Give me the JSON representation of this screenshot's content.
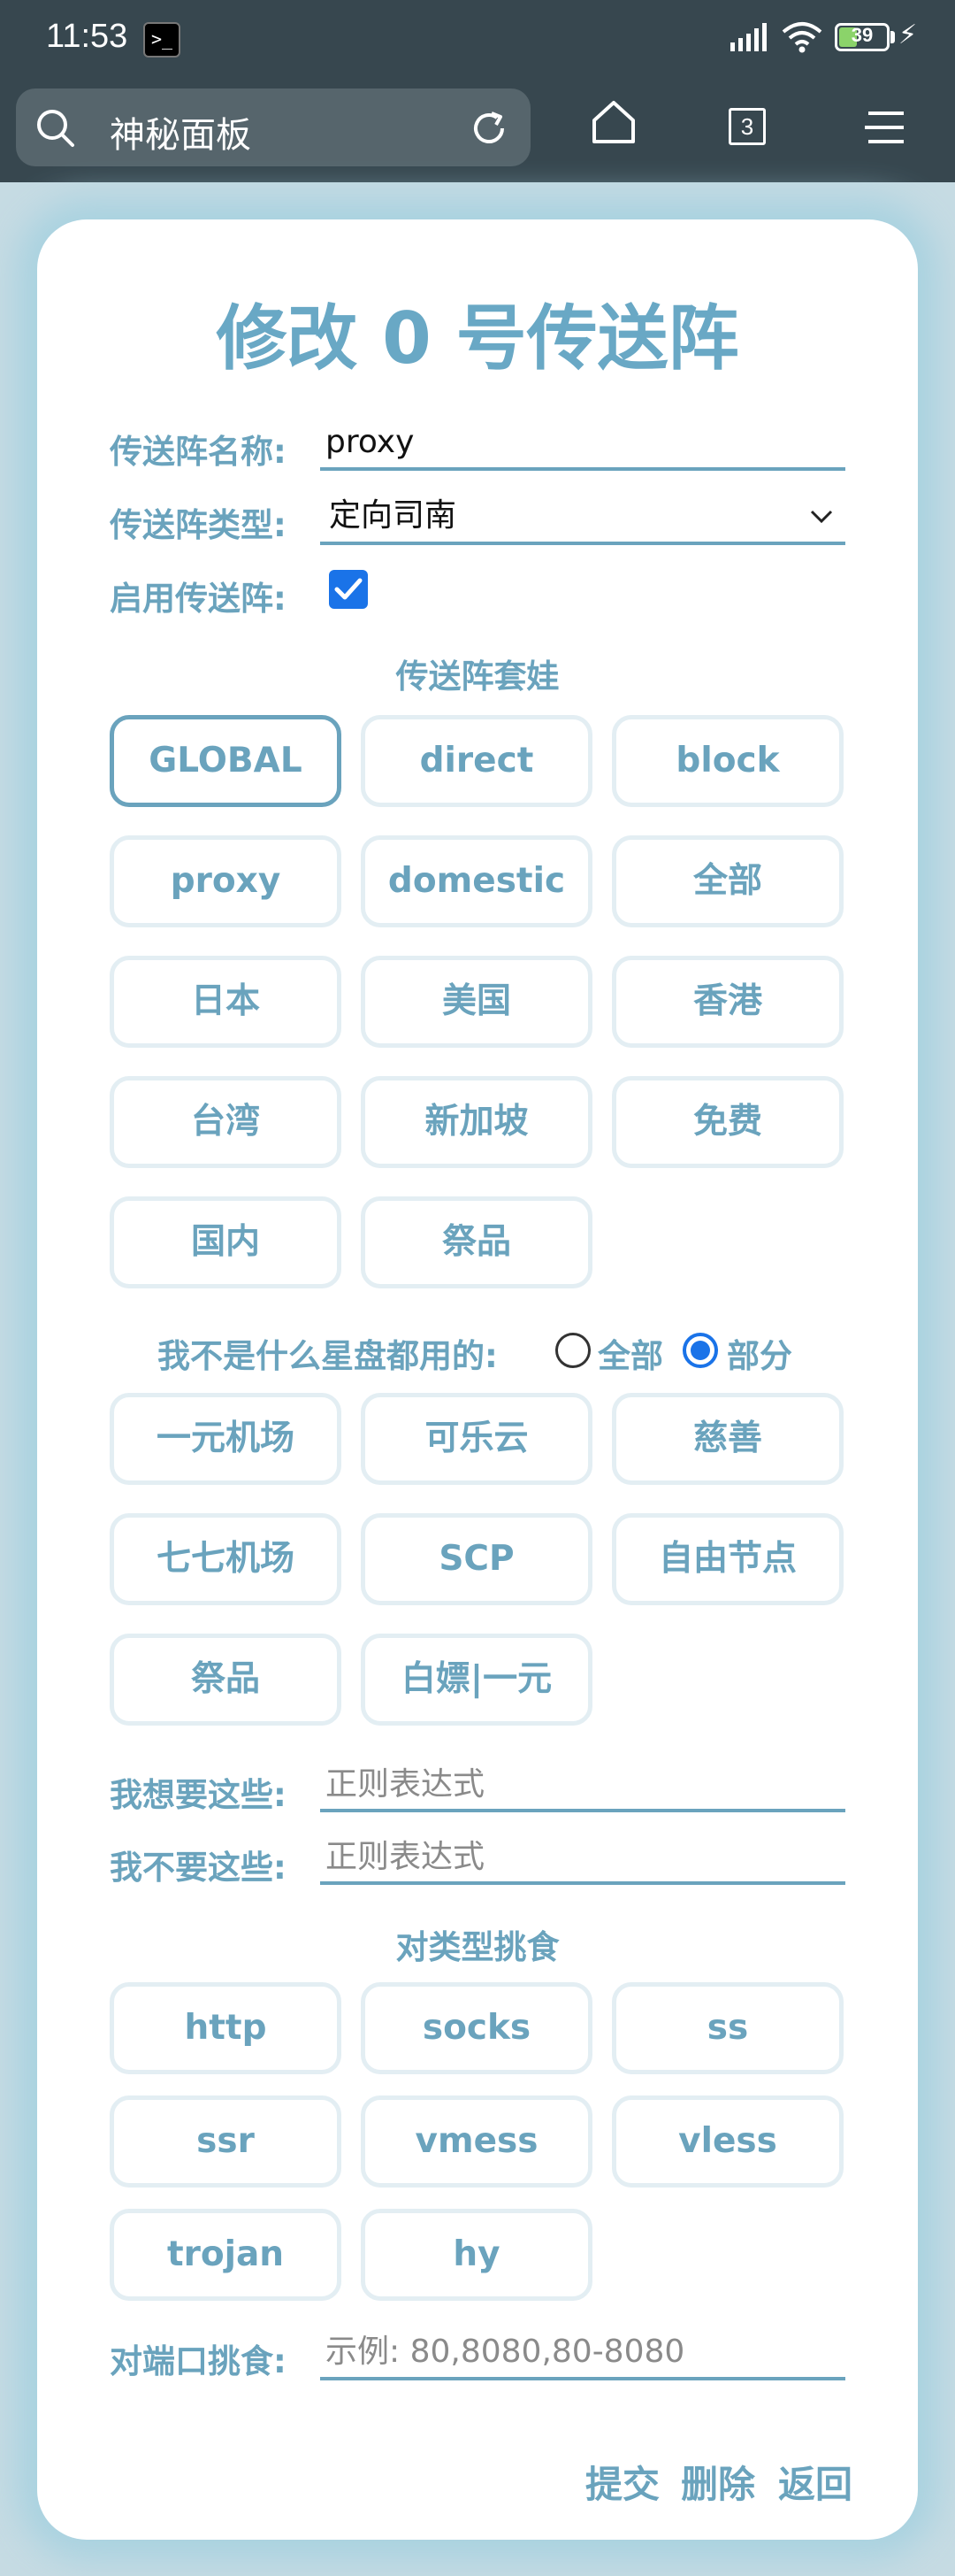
{
  "status": {
    "time": "11:53",
    "battery": "39"
  },
  "browser": {
    "title": "神秘面板",
    "tab_count": "3"
  },
  "form": {
    "title": "修改 0 号传送阵",
    "name_label": "传送阵名称:",
    "name_value": "proxy",
    "type_label": "传送阵类型:",
    "type_value": "定向司南",
    "enable_label": "启用传送阵:",
    "enabled": true,
    "nesting_title": "传送阵套娃",
    "nesting_chips": [
      "GLOBAL",
      "direct",
      "block",
      "proxy",
      "domestic",
      "全部",
      "日本",
      "美国",
      "香港",
      "台湾",
      "新加坡",
      "免费",
      "国内",
      "祭品"
    ],
    "nesting_selected": "GLOBAL",
    "airport_label": "我不是什么星盘都用的:",
    "radio_all": "全部",
    "radio_partial": "部分",
    "radio_selected": "部分",
    "airport_chips": [
      "一元机场",
      "可乐云",
      "慈善",
      "七七机场",
      "SCP",
      "自由节点",
      "祭品",
      "白嫖|一元"
    ],
    "want_label": "我想要这些:",
    "want_placeholder": "正则表达式",
    "dont_want_label": "我不要这些:",
    "dont_want_placeholder": "正则表达式",
    "protocol_title": "对类型挑食",
    "protocol_chips": [
      "http",
      "socks",
      "ss",
      "ssr",
      "vmess",
      "vless",
      "trojan",
      "hy"
    ],
    "port_label": "对端口挑食:",
    "port_placeholder": "示例: 80,8080,80-8080",
    "submit": "提交",
    "delete": "删除",
    "back": "返回"
  }
}
